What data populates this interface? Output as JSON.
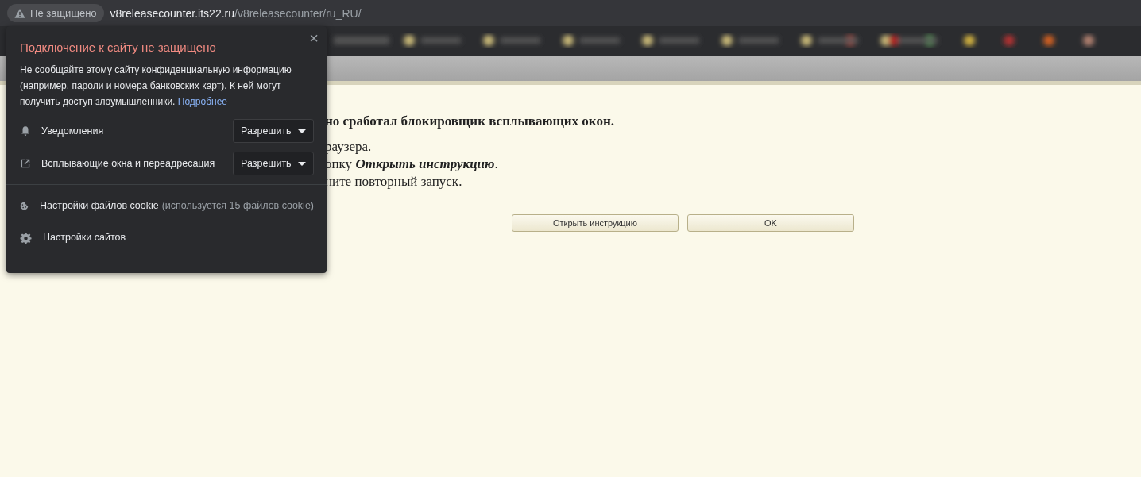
{
  "address_bar": {
    "security_chip": "Не защищено",
    "url_host": "v8releasecounter.its22.ru",
    "url_path": "/v8releasecounter/ru_RU/"
  },
  "page": {
    "heading": "но сработал блокировщик всплывающих окон.",
    "lines": [
      "раузера.",
      "опку **Открыть инструкцию**.",
      "ните повторный запуск."
    ],
    "buttons": [
      "Открыть инструкцию",
      "OK"
    ]
  },
  "site_info_popup": {
    "title": "Подключение к сайту не защищено",
    "close": "×",
    "message": "Не сообщайте этому сайту конфиденциальную информацию (например, пароли и номера банковских карт). К ней могут получить доступ злоумышленники.",
    "link": "Подробнее",
    "permissions": [
      {
        "kind": "bell",
        "label": "Уведомления",
        "value": "Разрешить"
      },
      {
        "kind": "popup",
        "label": "Всплывающие окна и переадресация",
        "value": "Разрешить"
      }
    ],
    "links": [
      {
        "kind": "cookie",
        "label": "Настройки файлов cookie",
        "note": "(используется 15 файлов cookie)"
      },
      {
        "kind": "gear",
        "label": "Настройки сайтов"
      }
    ]
  }
}
